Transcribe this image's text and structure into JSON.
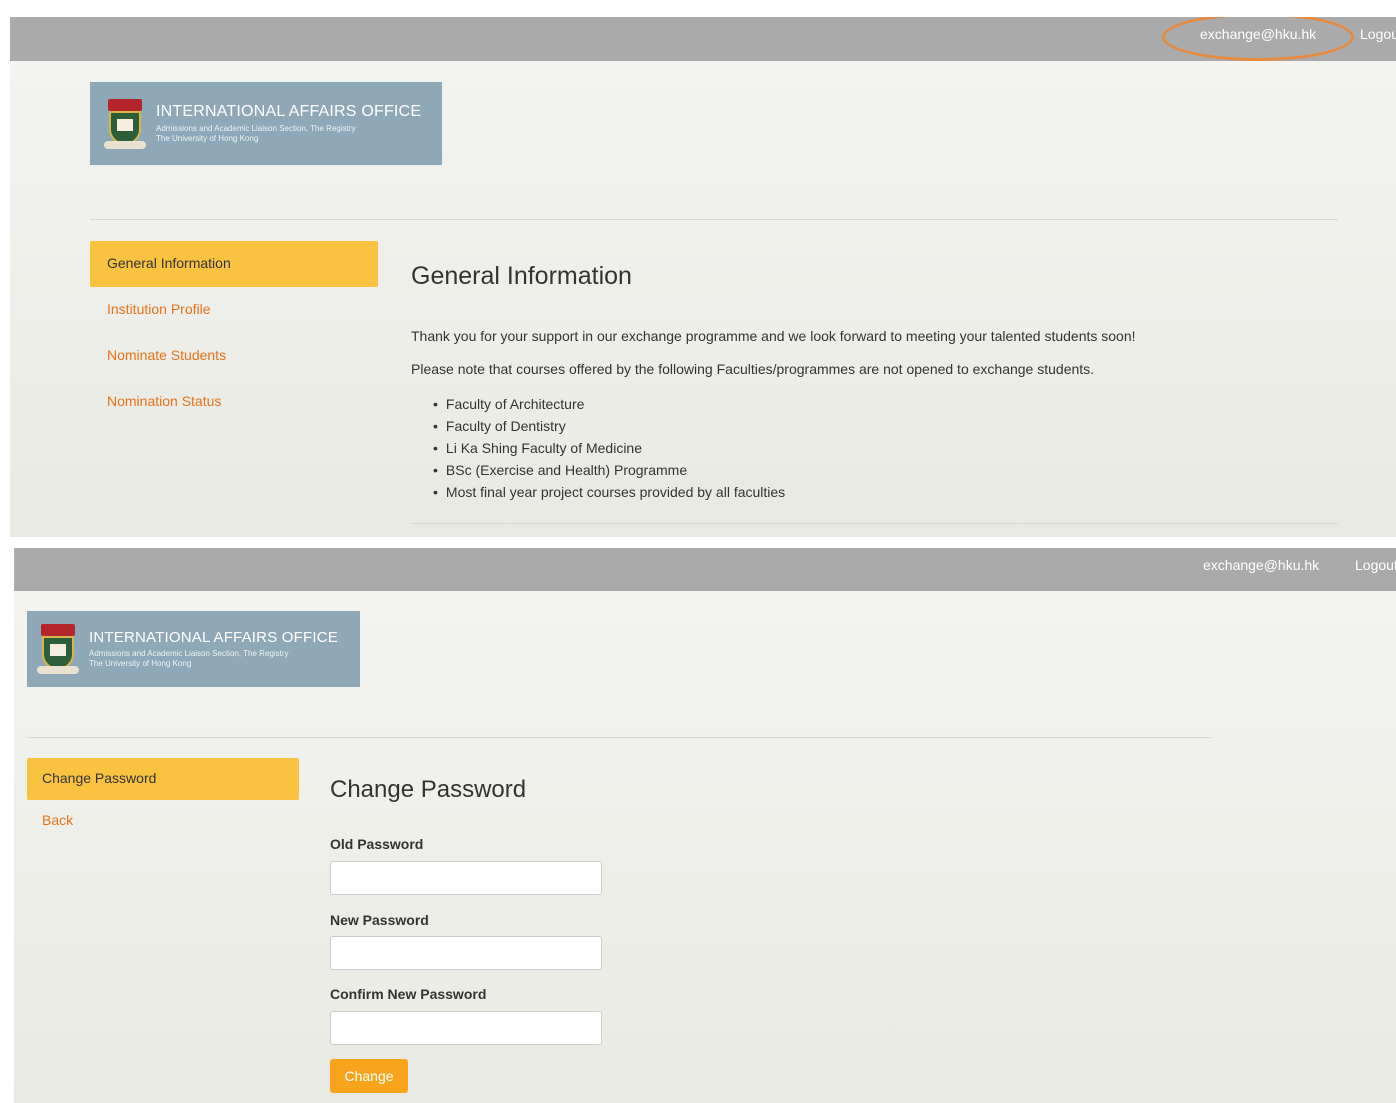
{
  "top_panel": {
    "topbar": {
      "user_email": "exchange@hku.hk",
      "logout_label": "Logout"
    },
    "banner": {
      "title": "INTERNATIONAL AFFAIRS OFFICE",
      "subtitle_line1": "Admissions and Academic Liaison Section, The Registry",
      "subtitle_line2": "The University of Hong Kong"
    },
    "sidebar": {
      "items": [
        {
          "label": "General Information",
          "active": true
        },
        {
          "label": "Institution Profile"
        },
        {
          "label": "Nominate Students"
        },
        {
          "label": "Nomination Status"
        }
      ]
    },
    "main": {
      "heading": "General Information",
      "paragraph1": "Thank you for your support in our exchange programme and we look forward to meeting your talented students soon!",
      "paragraph2": "Please note that courses offered by the following Faculties/programmes are not opened to exchange students.",
      "list": [
        "Faculty of Architecture",
        "Faculty of Dentistry",
        "Li Ka Shing Faculty of Medicine",
        "BSc (Exercise and Health) Programme",
        "Most final year project courses provided by all faculties"
      ]
    }
  },
  "bottom_panel": {
    "topbar": {
      "user_email": "exchange@hku.hk",
      "logout_label": "Logout"
    },
    "banner": {
      "title": "INTERNATIONAL AFFAIRS OFFICE",
      "subtitle_line1": "Admissions and Academic Liaison Section, The Registry",
      "subtitle_line2": "The University of Hong Kong"
    },
    "sidebar": {
      "items": [
        {
          "label": "Change Password",
          "active": true
        },
        {
          "label": "Back"
        }
      ]
    },
    "main": {
      "heading": "Change Password",
      "old_password_label": "Old Password",
      "old_password_value": "",
      "new_password_label": "New Password",
      "new_password_value": "",
      "confirm_password_label": "Confirm New Password",
      "confirm_password_value": "",
      "submit_label": "Change"
    }
  },
  "colors": {
    "topbar": "#aaaaaa",
    "nav_active": "#f9c341",
    "link": "#e8731a",
    "button": "#f8a31c",
    "highlight_ring": "#e58a3f",
    "banner": "#8fa8b8"
  }
}
